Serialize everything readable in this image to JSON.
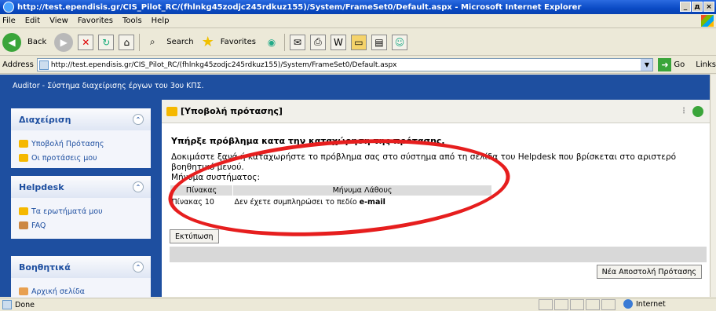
{
  "window": {
    "title": "http://test.ependisis.gr/CIS_Pilot_RC/(fhlnkg45zodjc245rdkuz155)/System/FrameSet0/Default.aspx - Microsoft Internet Explorer",
    "controls": [
      "_",
      "д",
      "×"
    ]
  },
  "menu": [
    "File",
    "Edit",
    "View",
    "Favorites",
    "Tools",
    "Help"
  ],
  "toolbar": {
    "back": "Back",
    "search": "Search",
    "favorites": "Favorites"
  },
  "address": {
    "label": "Address",
    "url": "http://test.ependisis.gr/CIS_Pilot_RC/(fhlnkg45zodjc245rdkuz155)/System/FrameSet0/Default.aspx",
    "go": "Go",
    "links": "Links"
  },
  "app": {
    "header": "Auditor - Σύστημα διαχείρισης έργων του 3ου ΚΠΣ."
  },
  "sidebar": {
    "panels": [
      {
        "title": "Διαχείριση",
        "items": [
          "Υποβολή Πρότασης",
          "Οι προτάσεις μου"
        ]
      },
      {
        "title": "Helpdesk",
        "items": [
          "Τα ερωτήματά μου",
          "FAQ"
        ]
      },
      {
        "title": "Βοηθητικά",
        "items": [
          "Αρχική σελίδα"
        ]
      }
    ]
  },
  "main": {
    "header": "[Υποβολή πρότασης]",
    "error_title": "Υπήρξε πρόβλημα κατα την καταχώρηση της πρότασης.",
    "error_text": "Δοκιμάστε ξανά ή καταχωρήστε το πρόβλημα σας στο σύστημα από τη σελίδα του Helpdesk που βρίσκεται στο αριστερό βοηθητικό μενού.",
    "system_message_label": "Μήνυμα συστήματος:",
    "table": {
      "headers": [
        "Πίνακας",
        "Μήνυμα Λάθους"
      ],
      "rows": [
        {
          "table": "Πίνακας 10",
          "message": "Δεν έχετε συμπληρώσει το πεδίο ",
          "field": "e-mail"
        }
      ]
    },
    "print_button": "Εκτύπωση",
    "new_button": "Νέα Αποστολή Πρότασης"
  },
  "status": {
    "left": "Done",
    "zone": "Internet"
  },
  "colors": {
    "app_blue": "#1e4fa0",
    "annotation_red": "#e61e1e"
  }
}
